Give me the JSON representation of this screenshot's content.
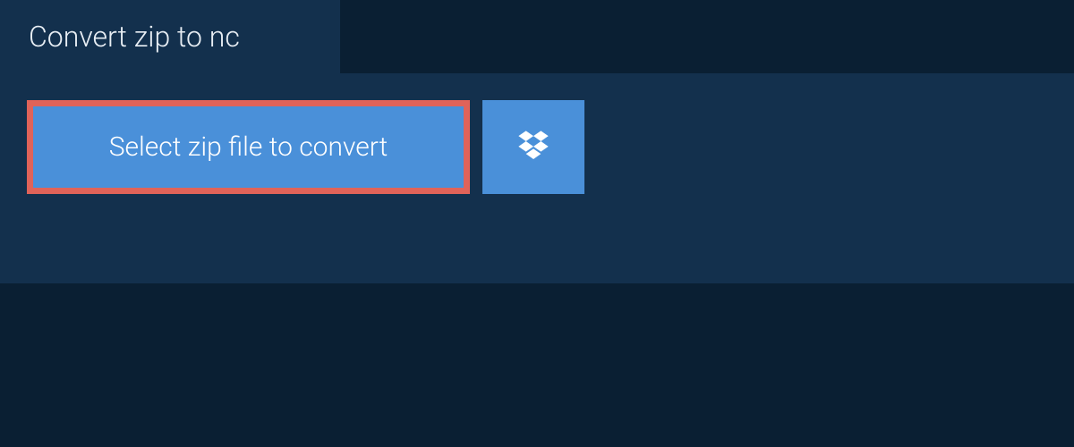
{
  "tab": {
    "title": "Convert zip to nc"
  },
  "actions": {
    "select_file_label": "Select zip file to convert"
  },
  "colors": {
    "background": "#0a1f33",
    "panel": "#13304d",
    "button": "#4a90d9",
    "highlight_border": "#e06359",
    "text_light": "#e8eef4",
    "text_white": "#ffffff"
  }
}
